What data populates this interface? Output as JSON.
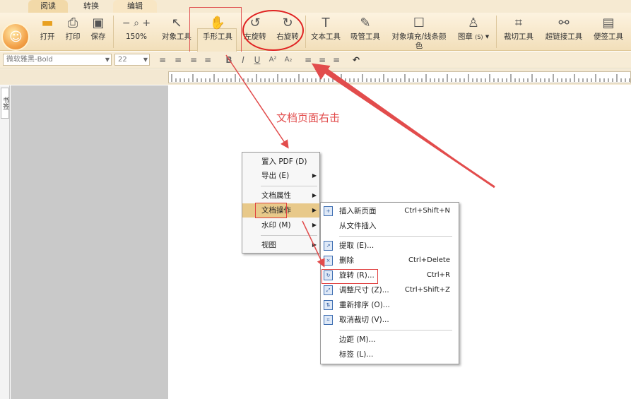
{
  "tabs": [
    {
      "id": "read",
      "label": "阅读"
    },
    {
      "id": "convert",
      "label": "转换"
    },
    {
      "id": "edit",
      "label": "编辑"
    }
  ],
  "toolbar": {
    "open": "打开",
    "print": "打印",
    "save": "保存",
    "zoom": "150%",
    "object_tool": "对象工具",
    "hand_tool": "手形工具",
    "rotate_left": "左旋转",
    "rotate_right": "右旋转",
    "text_tool": "文本工具",
    "eyedropper": "吸管工具",
    "fill_line_1": "对象填充/线条颜",
    "fill_line_2": "色",
    "stamp": "图章",
    "stamp_shortcut": "(S)",
    "crop_tool": "裁切工具",
    "link_tool": "超链接工具",
    "sticky_tool": "便签工具"
  },
  "format": {
    "font": "微软雅黑-Bold",
    "size": "22"
  },
  "left_panel": {
    "tab": "书签"
  },
  "annotation": "文档页面右击",
  "context_menu": {
    "items": [
      {
        "label": "置入 PDF (D)"
      },
      {
        "label": "导出 (E)",
        "submenu": true
      },
      {
        "label": "文档属性",
        "submenu": true
      },
      {
        "label": "文档操作",
        "submenu": true,
        "active": true
      },
      {
        "label": "水印 (M)",
        "submenu": true
      },
      {
        "label": "视图",
        "submenu": true
      }
    ]
  },
  "submenu": {
    "items": [
      {
        "label": "插入新页面",
        "shortcut": "Ctrl+Shift+N",
        "icon": "insert-page-icon"
      },
      {
        "label": "从文件插入",
        "shortcut": "",
        "icon": ""
      },
      {
        "label": "提取 (E)...",
        "shortcut": "",
        "icon": "extract-icon"
      },
      {
        "label": "删除",
        "shortcut": "Ctrl+Delete",
        "icon": "delete-page-icon"
      },
      {
        "label": "旋转 (R)...",
        "shortcut": "Ctrl+R",
        "icon": "rotate-page-icon"
      },
      {
        "label": "调整尺寸 (Z)...",
        "shortcut": "Ctrl+Shift+Z",
        "icon": "resize-icon"
      },
      {
        "label": "重新排序 (O)...",
        "shortcut": "",
        "icon": "reorder-icon"
      },
      {
        "label": "取消裁切 (V)...",
        "shortcut": "",
        "icon": "uncrop-icon"
      },
      {
        "label": "边距 (M)...",
        "shortcut": "",
        "icon": ""
      },
      {
        "label": "标签 (L)...",
        "shortcut": "",
        "icon": ""
      }
    ]
  },
  "colors": {
    "ribbon": "#f2dfba",
    "annotation": "#e24c4c",
    "menu_active": "#e8c98a"
  }
}
